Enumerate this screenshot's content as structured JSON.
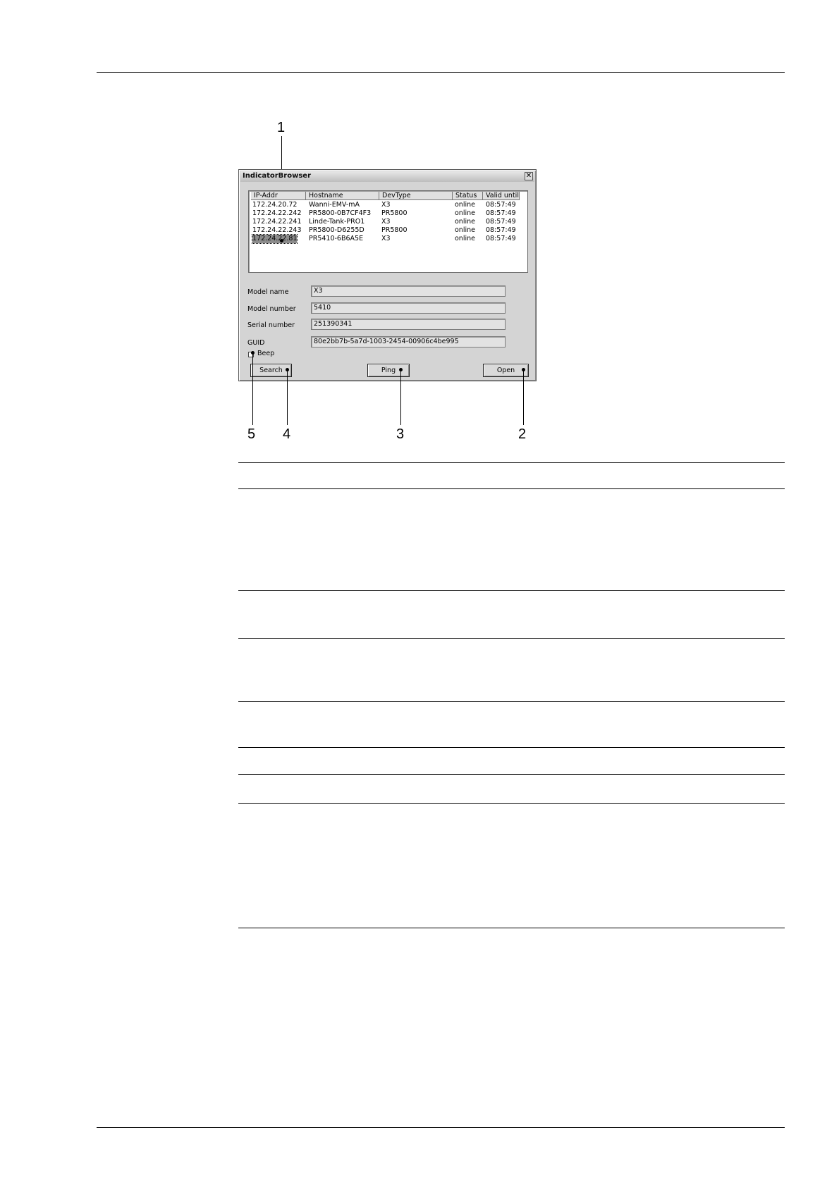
{
  "callouts": [
    "1",
    "2",
    "3",
    "4",
    "5"
  ],
  "dialog": {
    "title": "IndicatorBrowser",
    "close_glyph": "✕",
    "columns": [
      "IP-Addr",
      "Hostname",
      "DevType",
      "Status",
      "Valid until"
    ],
    "rows": [
      {
        "ip": "172.24.20.72",
        "host": "Wanni-EMV-mA",
        "type": "X3",
        "status": "online",
        "valid": "08:57:49"
      },
      {
        "ip": "172.24.22.242",
        "host": "PR5800-0B7CF4F3",
        "type": "PR5800",
        "status": "online",
        "valid": "08:57:49"
      },
      {
        "ip": "172.24.22.241",
        "host": "Linde-Tank-PRO1",
        "type": "X3",
        "status": "online",
        "valid": "08:57:49"
      },
      {
        "ip": "172.24.22.243",
        "host": "PR5800-D6255D",
        "type": "PR5800",
        "status": "online",
        "valid": "08:57:49"
      },
      {
        "ip": "172.24.22.81",
        "host": "PR5410-6B6A5E",
        "type": "X3",
        "status": "online",
        "valid": "08:57:49"
      }
    ],
    "fields": {
      "model_name": {
        "label": "Model name",
        "value": "X3"
      },
      "model_number": {
        "label": "Model number",
        "value": "5410"
      },
      "serial_number": {
        "label": "Serial number",
        "value": "251390341"
      },
      "guid": {
        "label": "GUID",
        "value": "80e2bb7b-5a7d-1003-2454-00906c4be995"
      }
    },
    "beep_label": "Beep",
    "buttons": {
      "search": "Search",
      "ping": "Ping",
      "open": "Open"
    }
  }
}
